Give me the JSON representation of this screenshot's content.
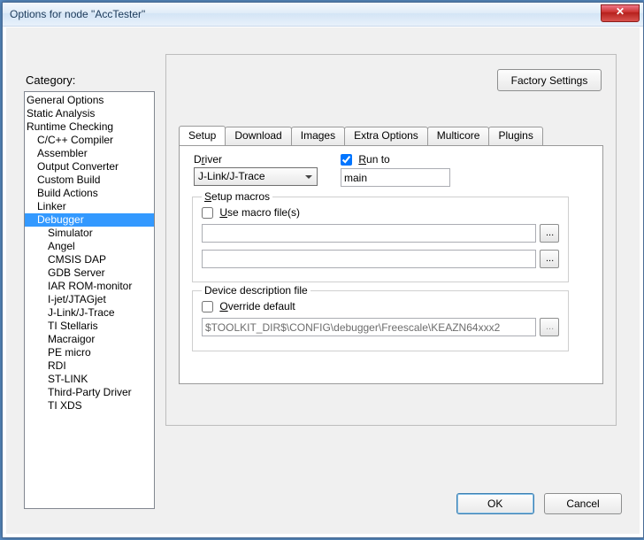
{
  "window": {
    "title": "Options for node \"AccTester\""
  },
  "category": {
    "label": "Category:",
    "items": [
      {
        "label": "General Options",
        "indent": false
      },
      {
        "label": "Static Analysis",
        "indent": false
      },
      {
        "label": "Runtime Checking",
        "indent": false
      },
      {
        "label": "C/C++ Compiler",
        "indent": true
      },
      {
        "label": "Assembler",
        "indent": true
      },
      {
        "label": "Output Converter",
        "indent": true
      },
      {
        "label": "Custom Build",
        "indent": true
      },
      {
        "label": "Build Actions",
        "indent": true
      },
      {
        "label": "Linker",
        "indent": true
      },
      {
        "label": "Debugger",
        "indent": true,
        "selected": true
      },
      {
        "label": "Simulator",
        "indent": true,
        "sub": true
      },
      {
        "label": "Angel",
        "indent": true,
        "sub": true
      },
      {
        "label": "CMSIS DAP",
        "indent": true,
        "sub": true
      },
      {
        "label": "GDB Server",
        "indent": true,
        "sub": true
      },
      {
        "label": "IAR ROM-monitor",
        "indent": true,
        "sub": true
      },
      {
        "label": "I-jet/JTAGjet",
        "indent": true,
        "sub": true
      },
      {
        "label": "J-Link/J-Trace",
        "indent": true,
        "sub": true
      },
      {
        "label": "TI Stellaris",
        "indent": true,
        "sub": true
      },
      {
        "label": "Macraigor",
        "indent": true,
        "sub": true
      },
      {
        "label": "PE micro",
        "indent": true,
        "sub": true
      },
      {
        "label": "RDI",
        "indent": true,
        "sub": true
      },
      {
        "label": "ST-LINK",
        "indent": true,
        "sub": true
      },
      {
        "label": "Third-Party Driver",
        "indent": true,
        "sub": true
      },
      {
        "label": "TI XDS",
        "indent": true,
        "sub": true
      }
    ]
  },
  "factory_button": "Factory Settings",
  "tabs": [
    "Setup",
    "Download",
    "Images",
    "Extra Options",
    "Multicore",
    "Plugins"
  ],
  "active_tab": 0,
  "setup": {
    "driver_label_pre": "D",
    "driver_label_u": "r",
    "driver_label_post": "iver",
    "driver_value": "J-Link/J-Trace",
    "runto_u": "R",
    "runto_post": "un to",
    "runto_checked": true,
    "runto_value": "main",
    "macros_legend_pre": "",
    "macros_legend_u": "S",
    "macros_legend_post": "etup macros",
    "use_macro_pre": "",
    "use_macro_u": "U",
    "use_macro_post": "se macro file(s)",
    "use_macro_checked": false,
    "macro_path1": "",
    "macro_path2": "",
    "ddf_legend": "Device description file",
    "override_u": "O",
    "override_post": "verride default",
    "override_checked": false,
    "ddf_value": "$TOOLKIT_DIR$\\CONFIG\\debugger\\Freescale\\KEAZN64xxx2",
    "browse": "..."
  },
  "buttons": {
    "ok": "OK",
    "cancel": "Cancel"
  }
}
